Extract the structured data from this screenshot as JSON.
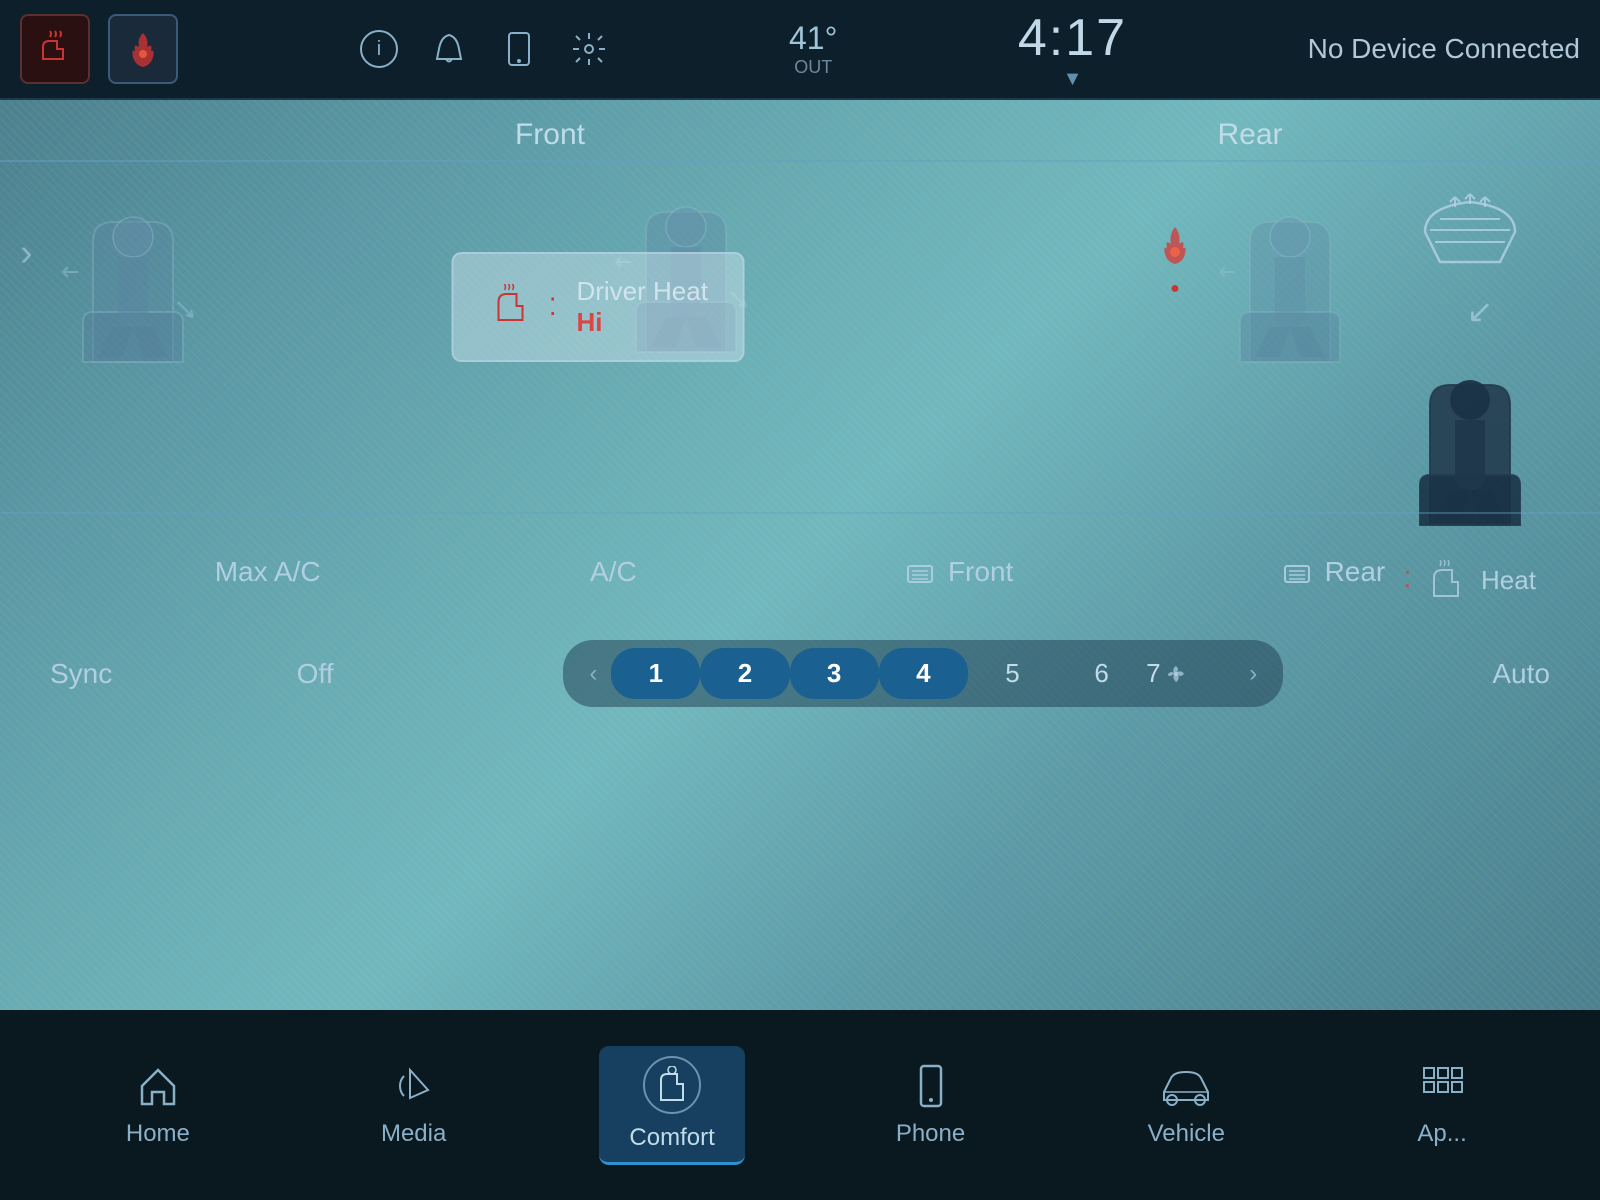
{
  "topbar": {
    "temperature": "41°",
    "temp_label": "OUT",
    "time": "4:17",
    "no_device": "No Device Connected"
  },
  "sections": {
    "front_label": "Front",
    "rear_label": "Rear"
  },
  "seat_controls": {
    "driver_heat_label": "Driver Heat",
    "driver_heat_level": "Hi",
    "heat_label": "Heat",
    "steering_label": "Heat"
  },
  "ac_controls": {
    "max_ac": "Max A/C",
    "ac": "A/C",
    "front": "Front",
    "rear": "Rear"
  },
  "fan": {
    "sync": "Sync",
    "off": "Off",
    "auto": "Auto",
    "prev": "‹",
    "next": "›",
    "speeds": [
      "1",
      "2",
      "3",
      "4",
      "5",
      "6",
      "7"
    ]
  },
  "nav": {
    "home": "Home",
    "media": "Media",
    "comfort": "Comfort",
    "phone": "Phone",
    "vehicle": "Vehicle",
    "apps": "Ap..."
  }
}
